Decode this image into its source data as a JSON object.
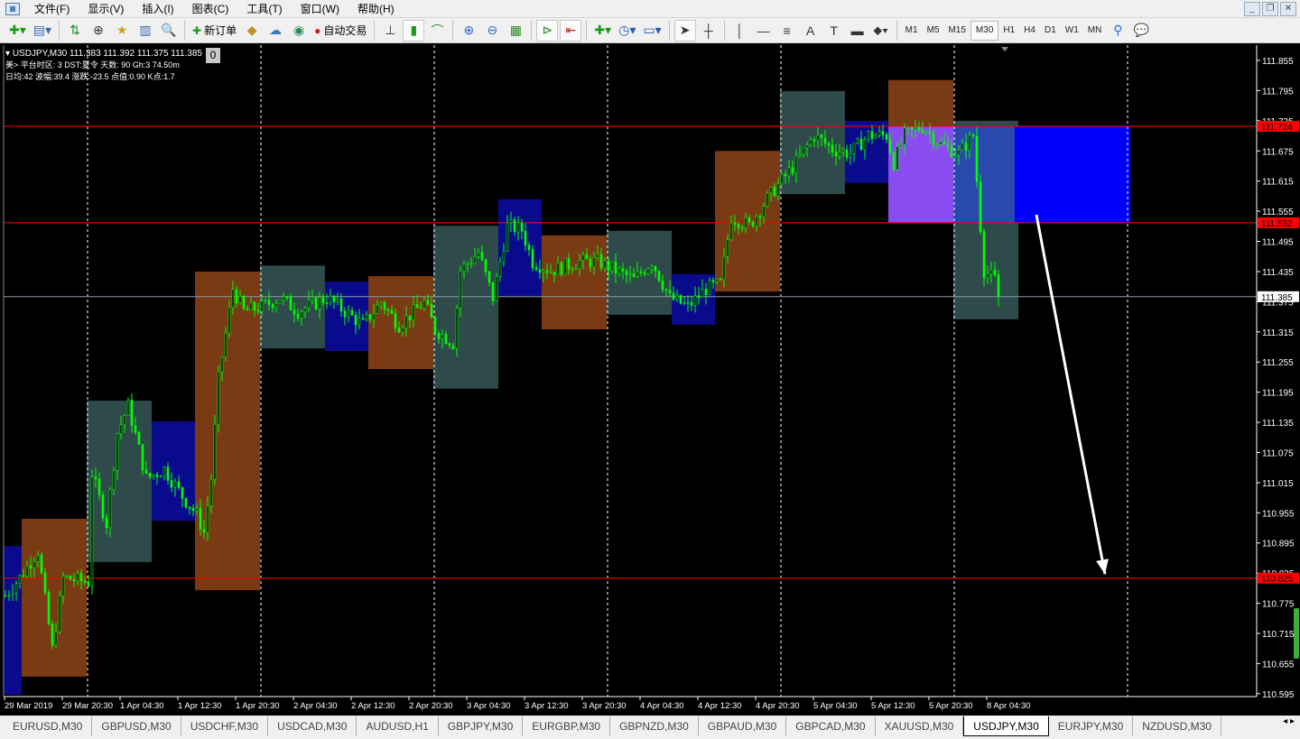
{
  "menu": [
    "文件(F)",
    "显示(V)",
    "插入(I)",
    "图表(C)",
    "工具(T)",
    "窗口(W)",
    "帮助(H)"
  ],
  "toolbar": {
    "new_order": "新订单",
    "auto_trading": "自动交易",
    "timeframes": [
      "M1",
      "M5",
      "M15",
      "M30",
      "H1",
      "H4",
      "D1",
      "W1",
      "MN"
    ],
    "active_timeframe": "M30"
  },
  "chart_info": {
    "line1": "USDJPY,M30  111.383 111.392 111.375 111.385",
    "line2": "美> 平台时区: 3  DST:夏令 天数:  90  Gh:3  74.50m",
    "line3": "日均:42  波幅:39.4  涨跌:-23.5  点值:0.90  K点:1.7",
    "badge": "0"
  },
  "chart_data": {
    "type": "candlestick",
    "symbol": "USDJPY",
    "timeframe": "M30",
    "ylim": [
      110.58,
      111.88
    ],
    "price_ticks": [
      "111.855",
      "111.795",
      "111.735",
      "111.675",
      "111.615",
      "111.555",
      "111.495",
      "111.435",
      "111.375",
      "111.315",
      "111.255",
      "111.195",
      "111.135",
      "111.075",
      "111.015",
      "110.955",
      "110.895",
      "110.835",
      "110.775",
      "110.715",
      "110.655",
      "110.595"
    ],
    "time_ticks": [
      "29 Mar 2019",
      "29 Mar 20:30",
      "1 Apr 04:30",
      "1 Apr 12:30",
      "1 Apr 20:30",
      "2 Apr 04:30",
      "2 Apr 12:30",
      "2 Apr 20:30",
      "3 Apr 04:30",
      "3 Apr 12:30",
      "3 Apr 20:30",
      "4 Apr 04:30",
      "4 Apr 12:30",
      "4 Apr 20:30",
      "5 Apr 04:30",
      "5 Apr 12:30",
      "5 Apr 20:30",
      "8 Apr 04:30"
    ],
    "price_path": [
      [
        0,
        110.79
      ],
      [
        4,
        110.826
      ],
      [
        9,
        110.88
      ],
      [
        13,
        110.683
      ],
      [
        16,
        110.826
      ],
      [
        23,
        110.817
      ],
      [
        24,
        111.033
      ],
      [
        28,
        110.934
      ],
      [
        31,
        111.114
      ],
      [
        34,
        111.167
      ],
      [
        39,
        111.024
      ],
      [
        44,
        111.042
      ],
      [
        49,
        110.988
      ],
      [
        53,
        110.952
      ],
      [
        55,
        110.916
      ],
      [
        57,
        111.024
      ],
      [
        59,
        111.221
      ],
      [
        63,
        111.401
      ],
      [
        66,
        111.356
      ],
      [
        71,
        111.365
      ],
      [
        76,
        111.383
      ],
      [
        81,
        111.356
      ],
      [
        89,
        111.383
      ],
      [
        94,
        111.356
      ],
      [
        99,
        111.329
      ],
      [
        104,
        111.374
      ],
      [
        109,
        111.329
      ],
      [
        116,
        111.374
      ],
      [
        119,
        111.32
      ],
      [
        124,
        111.293
      ],
      [
        126,
        111.437
      ],
      [
        131,
        111.473
      ],
      [
        135,
        111.383
      ],
      [
        139,
        111.526
      ],
      [
        143,
        111.518
      ],
      [
        146,
        111.455
      ],
      [
        151,
        111.437
      ],
      [
        159,
        111.455
      ],
      [
        164,
        111.455
      ],
      [
        169,
        111.437
      ],
      [
        174,
        111.419
      ],
      [
        179,
        111.455
      ],
      [
        184,
        111.383
      ],
      [
        189,
        111.365
      ],
      [
        194,
        111.401
      ],
      [
        198,
        111.41
      ],
      [
        201,
        111.544
      ],
      [
        206,
        111.526
      ],
      [
        211,
        111.58
      ],
      [
        215,
        111.616
      ],
      [
        219,
        111.652
      ],
      [
        224,
        111.706
      ],
      [
        229,
        111.679
      ],
      [
        234,
        111.67
      ],
      [
        239,
        111.706
      ],
      [
        244,
        111.706
      ],
      [
        246,
        111.652
      ],
      [
        249,
        111.706
      ],
      [
        254,
        111.724
      ],
      [
        259,
        111.688
      ],
      [
        264,
        111.67
      ],
      [
        268,
        111.706
      ],
      [
        270,
        111.526
      ],
      [
        271,
        111.437
      ],
      [
        274,
        111.419
      ],
      [
        275,
        111.385
      ]
    ],
    "session_boxes": [
      {
        "start": -1,
        "end": 4,
        "high": 110.889,
        "low": 110.593,
        "color": "#0a0a8c"
      },
      {
        "start": 5,
        "end": 22,
        "high": 110.943,
        "low": 110.629,
        "color": "#7a3a14"
      },
      {
        "start": 23,
        "end": 40,
        "high": 111.178,
        "low": 110.857,
        "color": "#2f4a4a"
      },
      {
        "start": 41,
        "end": 52,
        "high": 111.137,
        "low": 110.939,
        "color": "#0a0a8c"
      },
      {
        "start": 53,
        "end": 70,
        "high": 111.435,
        "low": 110.801,
        "color": "#7a3a14"
      },
      {
        "start": 71,
        "end": 88,
        "high": 111.447,
        "low": 111.282,
        "color": "#2f4a4a"
      },
      {
        "start": 89,
        "end": 100,
        "high": 111.415,
        "low": 111.277,
        "color": "#0a0a8c"
      },
      {
        "start": 101,
        "end": 118,
        "high": 111.426,
        "low": 111.241,
        "color": "#7a3a14"
      },
      {
        "start": 119,
        "end": 136,
        "high": 111.526,
        "low": 111.202,
        "color": "#2f4a4a"
      },
      {
        "start": 137,
        "end": 148,
        "high": 111.579,
        "low": 111.386,
        "color": "#0a0a8c"
      },
      {
        "start": 149,
        "end": 166,
        "high": 111.507,
        "low": 111.32,
        "color": "#7a3a14"
      },
      {
        "start": 167,
        "end": 184,
        "high": 111.516,
        "low": 111.349,
        "color": "#2f4a4a"
      },
      {
        "start": 185,
        "end": 196,
        "high": 111.43,
        "low": 111.329,
        "color": "#0a0a8c"
      },
      {
        "start": 197,
        "end": 214,
        "high": 111.675,
        "low": 111.395,
        "color": "#7a3a14"
      },
      {
        "start": 215,
        "end": 232,
        "high": 111.794,
        "low": 111.589,
        "color": "#2f4a4a"
      },
      {
        "start": 233,
        "end": 244,
        "high": 111.735,
        "low": 111.611,
        "color": "#0a0a8c"
      },
      {
        "start": 245,
        "end": 262,
        "high": 111.816,
        "low": 111.534,
        "color": "#7a3a14"
      },
      {
        "start": 263,
        "end": 280,
        "high": 111.735,
        "low": 111.34,
        "color": "#2f4a4a"
      }
    ],
    "zone_boxes": [
      {
        "start": 245,
        "end": 262,
        "high": 111.724,
        "low": 111.532,
        "color": "#8a4cf0"
      },
      {
        "start": 263,
        "end": 280,
        "high": 111.724,
        "low": 111.532,
        "color": "#2a4ad0"
      },
      {
        "start": 280,
        "end": 311,
        "high": 111.724,
        "low": 111.532,
        "color": "#0000ff"
      }
    ],
    "hlines": [
      {
        "price": 111.724,
        "label": "111.724",
        "color": "#ff0000"
      },
      {
        "price": 111.532,
        "label": "111.532",
        "color": "#ff0000"
      },
      {
        "price": 110.825,
        "label": "110.825",
        "color": "#ff0000"
      }
    ],
    "current_price": {
      "price": 111.385,
      "label": "111.385"
    },
    "arrow": {
      "from": [
        286,
        111.548
      ],
      "to": [
        305,
        110.833
      ]
    }
  },
  "tabs": [
    "EURUSD,M30",
    "GBPUSD,M30",
    "USDCHF,M30",
    "USDCAD,M30",
    "AUDUSD,H1",
    "GBPJPY,M30",
    "EURGBP,M30",
    "GBPNZD,M30",
    "GBPAUD,M30",
    "GBPCAD,M30",
    "XAUUSD,M30",
    "USDJPY,M30",
    "EURJPY,M30",
    "NZDUSD,M30"
  ],
  "active_tab": "USDJPY,M30"
}
